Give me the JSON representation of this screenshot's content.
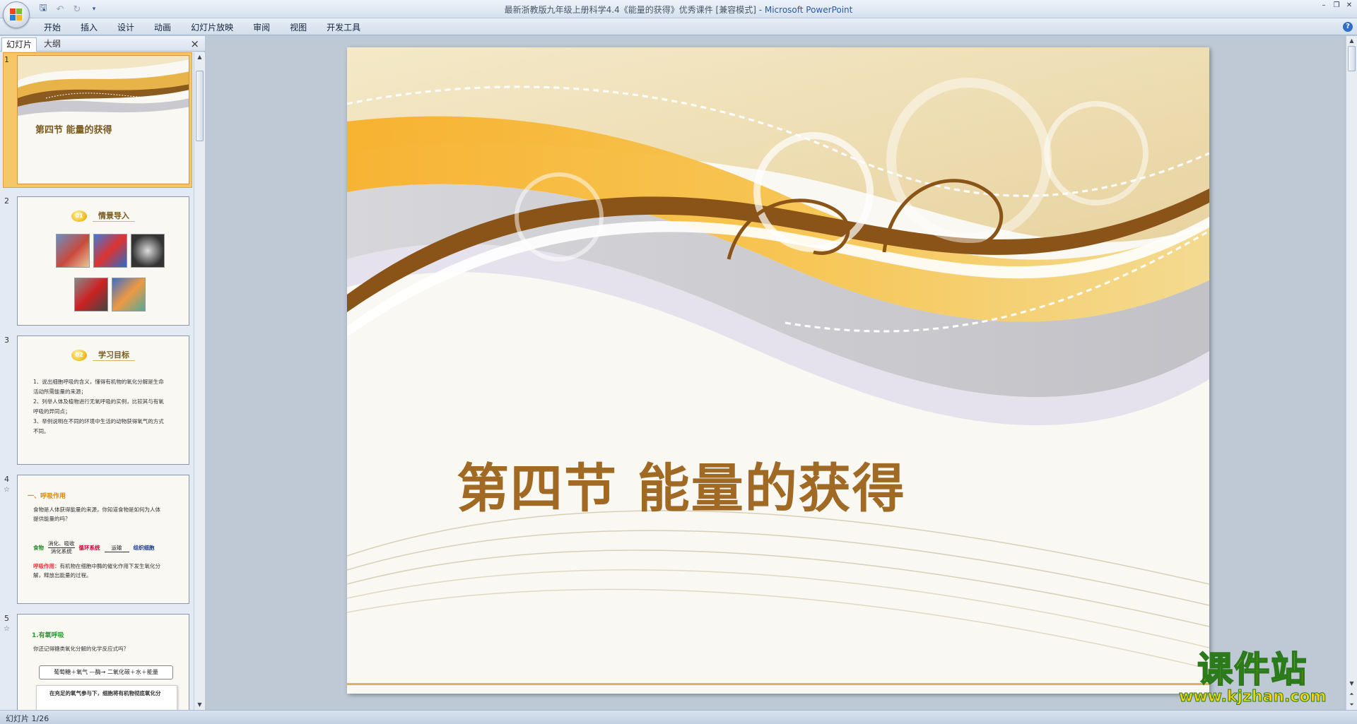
{
  "window": {
    "title": "最新浙教版九年级上册科学4.4《能量的获得》优秀课件 [兼容模式] - ",
    "app_name": "Microsoft PowerPoint"
  },
  "quick_access": {
    "save_icon": "save-icon",
    "undo_icon": "undo-icon",
    "redo_icon": "redo-icon",
    "more_icon": "▾"
  },
  "ribbon": {
    "tabs": [
      "开始",
      "插入",
      "设计",
      "动画",
      "幻灯片放映",
      "审阅",
      "视图",
      "开发工具"
    ]
  },
  "left_pane": {
    "tabs": {
      "slides": "幻灯片",
      "outline": "大纲"
    },
    "close": "×",
    "slides": [
      {
        "number": "1",
        "title": "第四节  能量的获得"
      },
      {
        "number": "2",
        "badge": "01",
        "title": "情景导入"
      },
      {
        "number": "3",
        "badge": "02",
        "title": "学习目标",
        "lines": [
          "1、说出细胞呼吸的含义，懂得有机物的氧化分解是生命",
          "活动所需能量的来源；",
          "2、列举人体及植物进行无氧呼吸的实例，比较其与有氧",
          "呼吸的异同点；",
          "3、举例说明在不同的环境中生活的动物获得氧气的方式",
          "不同。"
        ]
      },
      {
        "number": "4",
        "heading": "一、呼吸作用",
        "q1": "食物是人体获得能量的来源，你知道食物是如何为人体",
        "q2": "提供能量的吗？",
        "flow": [
          "食物",
          "消化、吸收",
          "消化系统",
          "循环系统",
          "运输",
          "组织细胞"
        ],
        "def_label": "呼吸作用：",
        "def": "有机物在细胞中酶的催化作用下发生氧化分",
        "def2": "解，释放出能量的过程。"
      },
      {
        "number": "5",
        "heading": "1.有氧呼吸",
        "question": "你还记得糖类氧化分解的化学反应式吗？",
        "equation": "葡萄糖＋氧气 —酶→ 二氧化碳＋水＋能量",
        "note": "在充足的氧气参与下，细胞将有机物彻底氧化分"
      }
    ]
  },
  "main_slide": {
    "title": "第四节  能量的获得"
  },
  "watermark": {
    "text": "课件站",
    "url": "www.kjzhan.com"
  },
  "status": {
    "text": "幻灯片 1/26"
  },
  "colors": {
    "accent": "#f5a623",
    "title_brown": "#a06a25",
    "ribbon_blue": "#d3deec"
  }
}
